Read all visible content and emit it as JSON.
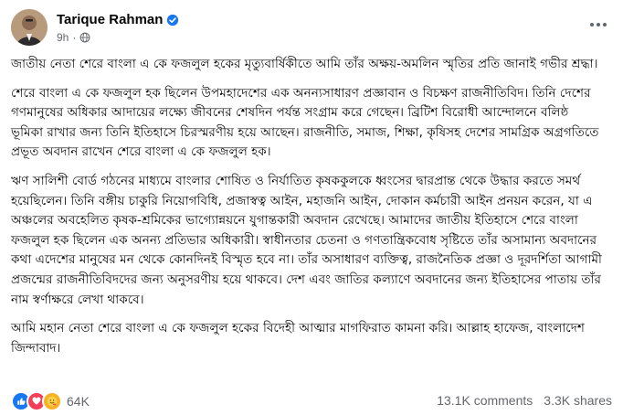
{
  "post": {
    "author": "Tarique Rahman",
    "time": "9h",
    "separator": "·",
    "paragraphs": [
      "জাতীয় নেতা শেরে বাংলা এ কে ফজলুল হকের মৃত্যুবার্ষিকীতে আমি তাঁর অক্ষয়-অমলিন স্মৃতির প্রতি জানাই গভীর শ্রদ্ধা।",
      "শেরে বাংলা এ কে ফজলুল হক ছিলেন উপমহাদেশের এক অনন্যসাধারণ প্রজ্ঞাবান ও বিচক্ষণ রাজনীতিবিদ। তিনি দেশের গণমানুষের অধিকার আদায়ের লক্ষ্যে জীবনের শেষদিন পর্যন্ত সংগ্রাম করে গেছেন। ব্রিটিশ বিরোধী আন্দোলনে বলিষ্ঠ ভূমিকা রাখার জন্য তিনি ইতিহাসে চিরস্মরণীয় হয়ে আছেন। রাজনীতি, সমাজ, শিক্ষা, কৃষিসহ দেশের সামগ্রিক অগ্রগতিতে প্রভূত অবদান রাখেন শেরে বাংলা এ কে ফজলুল হক।",
      "ঋণ সালিশী বোর্ড গঠনের মাধ্যমে বাংলার শোষিত ও নির্যাতিত কৃষককুলকে ধ্বংসের দ্বারপ্রান্ত থেকে উদ্ধার করতে সমর্থ হয়েছিলেন। তিনি বঙ্গীয় চাকুরি নিয়োগবিধি, প্রজাস্বত্ব আইন, মহাজনি আইন, দোকান কর্মচারী আইন প্রনয়ন করেন, যা এ অঞ্চলের অবহেলিত কৃষক-শ্রমিকের ভাগ্যোন্নয়নে যুগান্তকারী অবদান রেখেছে। আমাদের জাতীয় ইতিহাসে শেরে বাংলা ফজলুল হক ছিলেন এক অনন্য প্রতিভার অধিকারী। স্বাধীনতার চেতনা ও গণতান্ত্রিকবোধ সৃষ্টিতে তাঁর অসামান্য অবদানের কথা এদেশের মানুষের মন থেকে কোনদিনই বিস্মৃত হবে না। তাঁর অসাধারণ ব্যক্তিত্ব, রাজনৈতিক প্রজ্ঞা ও দূরদর্শিতা আগামী প্রজন্মের রাজনীতিবিদদের জন্য অনুসরণীয় হয়ে থাকবে। দেশ এবং জাতির কল্যাণে অবদানের জন্য ইতিহাসের পাতায় তাঁর নাম স্বর্ণাক্ষরে লেখা থাকবে।",
      "আমি মহান নেতা শেরে বাংলা এ কে ফজলুল হকের বিদেহী আত্মার মাগফিরাত কামনা করি। আল্লাহ হাফেজ, বাংলাদেশ জিন্দাবাদ।"
    ],
    "reactions_count": "64K",
    "comments_count": "13.1K comments",
    "shares_count": "3.3K shares"
  },
  "icons": {
    "verified": "verified-badge-icon",
    "privacy": "globe-icon",
    "more": "more-options-icon",
    "like": "like-reaction-icon",
    "love": "love-reaction-icon",
    "care": "care-reaction-icon"
  },
  "colors": {
    "brand_blue": "#1877f2",
    "love_red": "#f33e58",
    "care_yellow": "#f7b125",
    "meta_gray": "#65676b"
  }
}
